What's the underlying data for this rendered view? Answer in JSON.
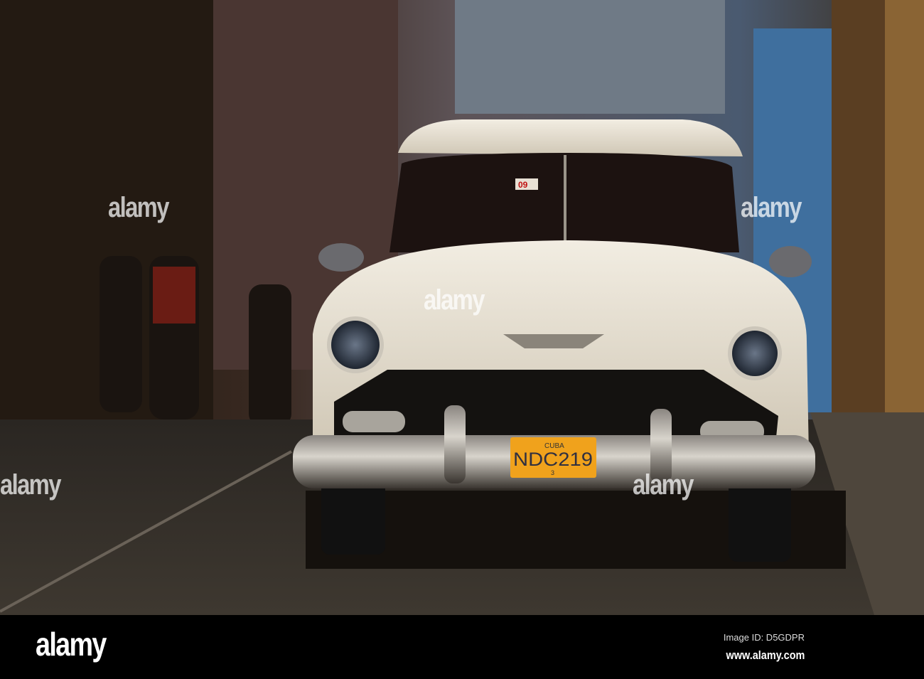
{
  "photo": {
    "subject": "white classic car on street",
    "plate": {
      "country": "CUBA",
      "number": "NDC219",
      "sub": "3"
    },
    "windshield_sticker": "09"
  },
  "watermark": "alamy",
  "footer": {
    "logo": "alamy",
    "image_id": "Image ID: D5GDPR",
    "website": "www.alamy.com"
  },
  "colors": {
    "body": "#e9e3d6",
    "plate": "#f0a21c",
    "footer": "#000000"
  }
}
